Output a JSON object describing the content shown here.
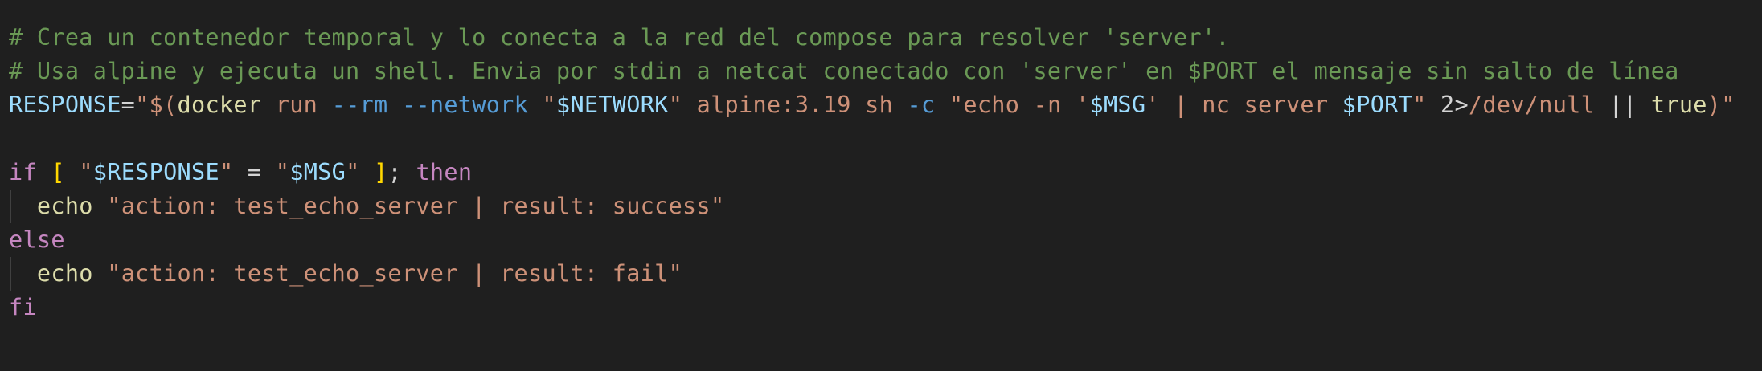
{
  "editor": {
    "language": "shell",
    "colors": {
      "background": "#1f1f1f",
      "comment": "#6a9955",
      "variable": "#9cdcfe",
      "string": "#ce9178",
      "keyword": "#c586c0",
      "function": "#dcdcaa",
      "flag": "#569cd6",
      "bracket": "#ffd700",
      "default": "#d4d4d4"
    },
    "lines": [
      {
        "indent": false,
        "tokens": [
          [
            "# Crea un contenedor temporal y lo conecta a la red del compose para resolver 'server'.",
            "comment"
          ]
        ]
      },
      {
        "indent": false,
        "tokens": [
          [
            "# Usa alpine y ejecuta un shell. Envia por stdin a netcat conectado con 'server' en $PORT el mensaje sin salto de línea",
            "comment"
          ]
        ]
      },
      {
        "indent": false,
        "tokens": [
          [
            "RESPONSE",
            "var"
          ],
          [
            "=",
            "op"
          ],
          [
            "\"$(",
            "str"
          ],
          [
            "docker",
            "fn"
          ],
          [
            " ",
            "op"
          ],
          [
            "run",
            "str"
          ],
          [
            " ",
            "op"
          ],
          [
            "--rm",
            "flag"
          ],
          [
            " ",
            "op"
          ],
          [
            "--network",
            "flag"
          ],
          [
            " ",
            "op"
          ],
          [
            "\"",
            "str"
          ],
          [
            "$NETWORK",
            "var"
          ],
          [
            "\"",
            "str"
          ],
          [
            " ",
            "op"
          ],
          [
            "alpine:3.19",
            "str"
          ],
          [
            " ",
            "op"
          ],
          [
            "sh",
            "str"
          ],
          [
            " ",
            "op"
          ],
          [
            "-c",
            "flag"
          ],
          [
            " ",
            "op"
          ],
          [
            "\"echo -n '",
            "str"
          ],
          [
            "$MSG",
            "var"
          ],
          [
            "' | nc server ",
            "str"
          ],
          [
            "$PORT",
            "var"
          ],
          [
            "\"",
            "str"
          ],
          [
            " 2>",
            "op"
          ],
          [
            "/dev/null",
            "str"
          ],
          [
            " || ",
            "op"
          ],
          [
            "true",
            "fn"
          ],
          [
            ")\"",
            "str"
          ]
        ]
      },
      {
        "indent": false,
        "tokens": [
          [
            "",
            "op"
          ]
        ]
      },
      {
        "indent": false,
        "tokens": [
          [
            "if",
            "kw"
          ],
          [
            " ",
            "op"
          ],
          [
            "[",
            "br"
          ],
          [
            " ",
            "op"
          ],
          [
            "\"",
            "str"
          ],
          [
            "$RESPONSE",
            "var"
          ],
          [
            "\"",
            "str"
          ],
          [
            " = ",
            "op"
          ],
          [
            "\"",
            "str"
          ],
          [
            "$MSG",
            "var"
          ],
          [
            "\"",
            "str"
          ],
          [
            " ",
            "op"
          ],
          [
            "]",
            "br"
          ],
          [
            "; ",
            "op"
          ],
          [
            "then",
            "kw"
          ]
        ]
      },
      {
        "indent": true,
        "tokens": [
          [
            "  ",
            "op"
          ],
          [
            "echo",
            "fn"
          ],
          [
            " ",
            "op"
          ],
          [
            "\"action: test_echo_server | result: success\"",
            "str"
          ]
        ]
      },
      {
        "indent": false,
        "tokens": [
          [
            "else",
            "kw"
          ]
        ]
      },
      {
        "indent": true,
        "tokens": [
          [
            "  ",
            "op"
          ],
          [
            "echo",
            "fn"
          ],
          [
            " ",
            "op"
          ],
          [
            "\"action: test_echo_server | result: fail\"",
            "str"
          ]
        ]
      },
      {
        "indent": false,
        "tokens": [
          [
            "fi",
            "kw"
          ]
        ]
      }
    ]
  }
}
